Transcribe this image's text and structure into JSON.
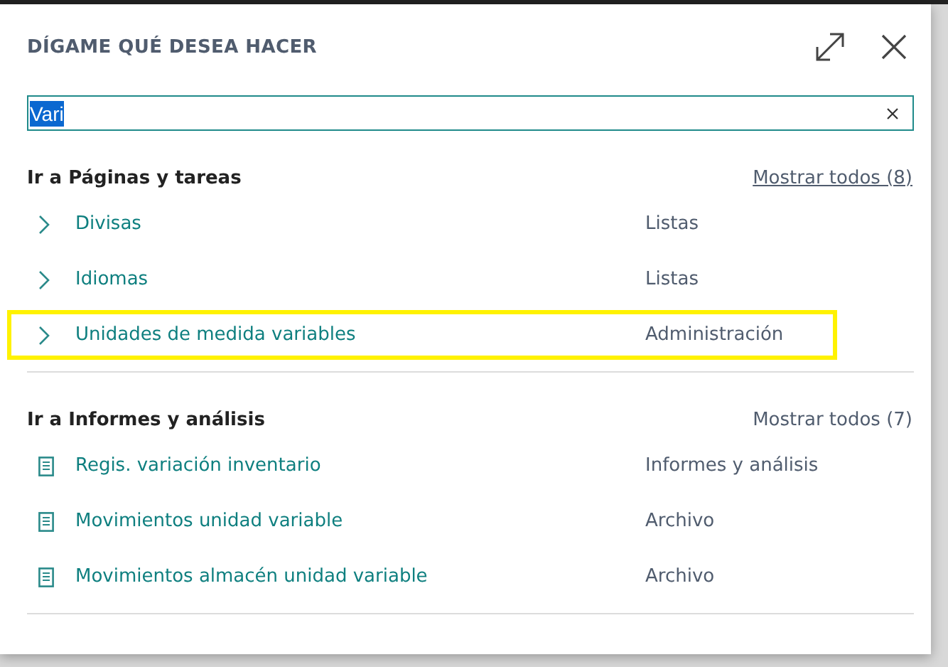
{
  "dialog": {
    "title": "DÍGAME QUÉ DESEA HACER"
  },
  "search": {
    "value": "Vari",
    "text_selected": true
  },
  "sections": [
    {
      "heading": "Ir a Páginas y tareas",
      "show_all": {
        "label": "Mostrar todos (8)",
        "focused": true
      },
      "items": [
        {
          "kind": "page",
          "label": "Divisas",
          "category": "Listas",
          "highlighted": false
        },
        {
          "kind": "page",
          "label": "Idiomas",
          "category": "Listas",
          "highlighted": false
        },
        {
          "kind": "page",
          "label": "Unidades de medida variables",
          "category": "Administración",
          "highlighted": true
        }
      ]
    },
    {
      "heading": "Ir a Informes y análisis",
      "show_all": {
        "label": "Mostrar todos (7)",
        "focused": false
      },
      "items": [
        {
          "kind": "report",
          "label": "Regis. variación inventario",
          "category": "Informes y análisis",
          "highlighted": false
        },
        {
          "kind": "report",
          "label": "Movimientos unidad variable",
          "category": "Archivo",
          "highlighted": false
        },
        {
          "kind": "report",
          "label": "Movimientos almacén unidad variable",
          "category": "Archivo",
          "highlighted": false
        }
      ]
    }
  ]
}
